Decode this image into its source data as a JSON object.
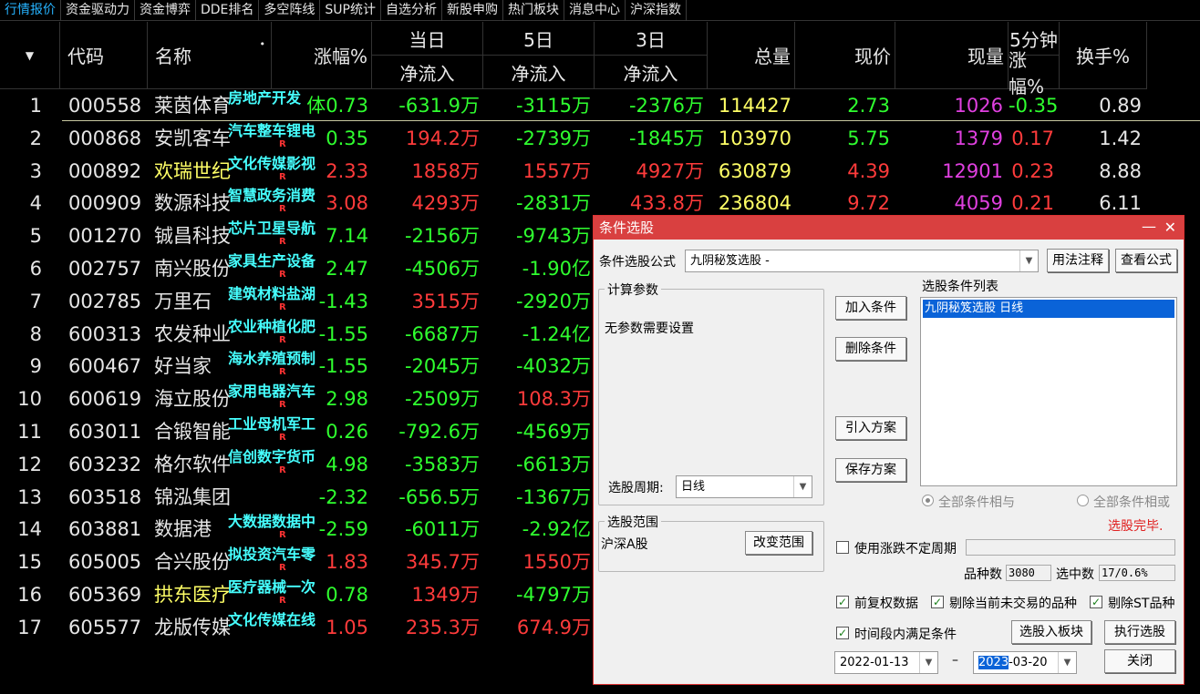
{
  "tabs": [
    "行情报价",
    "资金驱动力",
    "资金博弈",
    "DDE排名",
    "多空阵线",
    "SUP统计",
    "自选分析",
    "新股申购",
    "热门板块",
    "消息中心",
    "沪深指数"
  ],
  "header": {
    "sort_symbol": "▼",
    "code": "代码",
    "name": "名称",
    "name_dot": "•",
    "change": "涨幅%",
    "day": "当日",
    "five_day": "5日",
    "three_day": "3日",
    "net_inflow": "净流入",
    "volume": "总量",
    "price": "现价",
    "current_vol": "现量",
    "five_min": "5分钟",
    "five_min_change": "涨幅%",
    "turnover": "换手%"
  },
  "colors": {
    "red": "#ff3b3b",
    "green": "#2fff2f",
    "yellow": "#ffff66",
    "magenta": "#e040e0",
    "cyan": "#46ffff",
    "white": "#e6e6e6"
  },
  "rows": [
    {
      "idx": "1",
      "code": "000558",
      "name": "莱茵体育",
      "ind": "房地产开发",
      "r": "",
      "chg": "体0.73",
      "chg_c": "green",
      "day": "-631.9万",
      "day_c": "green",
      "d5": "-3115万",
      "d5_c": "green",
      "d3": "-2376万",
      "d3_c": "green",
      "vol": "114427",
      "price": "2.73",
      "price_c": "green",
      "cur": "1026",
      "m5": "-0.35",
      "m5_c": "green",
      "turn": "0.89",
      "name_yellow": false
    },
    {
      "idx": "2",
      "code": "000868",
      "name": "安凯客车",
      "ind": "汽车整车锂电",
      "r": "R",
      "chg": "0.35",
      "chg_c": "green",
      "day": "194.2万",
      "day_c": "red",
      "d5": "-2739万",
      "d5_c": "green",
      "d3": "-1845万",
      "d3_c": "green",
      "vol": "103970",
      "price": "5.75",
      "price_c": "green",
      "cur": "1379",
      "m5": "0.17",
      "m5_c": "red",
      "turn": "1.42",
      "name_yellow": false
    },
    {
      "idx": "3",
      "code": "000892",
      "name": "欢瑞世纪",
      "ind": "文化传媒影视",
      "r": "R",
      "chg": "2.33",
      "chg_c": "red",
      "day": "1858万",
      "day_c": "red",
      "d5": "1557万",
      "d5_c": "red",
      "d3": "4927万",
      "d3_c": "red",
      "vol": "630879",
      "price": "4.39",
      "price_c": "red",
      "cur": "12901",
      "m5": "0.23",
      "m5_c": "red",
      "turn": "8.88",
      "name_yellow": true
    },
    {
      "idx": "4",
      "code": "000909",
      "name": "数源科技",
      "ind": "智慧政务消费",
      "r": "R",
      "chg": "3.08",
      "chg_c": "red",
      "day": "4293万",
      "day_c": "red",
      "d5": "-2831万",
      "d5_c": "green",
      "d3": "433.8万",
      "d3_c": "red",
      "vol": "236804",
      "price": "9.72",
      "price_c": "red",
      "cur": "4059",
      "m5": "0.21",
      "m5_c": "red",
      "turn": "6.11",
      "name_yellow": false
    },
    {
      "idx": "5",
      "code": "001270",
      "name": "铖昌科技",
      "ind": "芯片卫星导航",
      "r": "R",
      "chg": "7.14",
      "chg_c": "green",
      "day": "-2156万",
      "day_c": "green",
      "d5": "-9743万",
      "d5_c": "green",
      "name_yellow": false
    },
    {
      "idx": "6",
      "code": "002757",
      "name": "南兴股份",
      "ind": "家具生产设备",
      "r": "R",
      "chg": "2.47",
      "chg_c": "green",
      "day": "-4506万",
      "day_c": "green",
      "d5": "-1.90亿",
      "d5_c": "green",
      "name_yellow": false
    },
    {
      "idx": "7",
      "code": "002785",
      "name": "万里石",
      "ind": "建筑材料盐湖",
      "r": "R",
      "chg": "-1.43",
      "chg_c": "green",
      "day": "3515万",
      "day_c": "red",
      "d5": "-2920万",
      "d5_c": "green",
      "name_yellow": false
    },
    {
      "idx": "8",
      "code": "600313",
      "name": "农发种业",
      "ind": "农业种植化肥",
      "r": "R",
      "chg": "-1.55",
      "chg_c": "green",
      "day": "-6687万",
      "day_c": "green",
      "d5": "-1.24亿",
      "d5_c": "green",
      "name_yellow": false
    },
    {
      "idx": "9",
      "code": "600467",
      "name": "好当家",
      "ind": "海水养殖预制",
      "r": "R",
      "chg": "-1.55",
      "chg_c": "green",
      "day": "-2045万",
      "day_c": "green",
      "d5": "-4032万",
      "d5_c": "green",
      "name_yellow": false
    },
    {
      "idx": "10",
      "code": "600619",
      "name": "海立股份",
      "ind": "家用电器汽车",
      "r": "R",
      "chg": "2.98",
      "chg_c": "green",
      "day": "-2509万",
      "day_c": "green",
      "d5": "108.3万",
      "d5_c": "red",
      "name_yellow": false
    },
    {
      "idx": "11",
      "code": "603011",
      "name": "合锻智能",
      "ind": "工业母机军工",
      "r": "R",
      "chg": "0.26",
      "chg_c": "green",
      "day": "-792.6万",
      "day_c": "green",
      "d5": "-4569万",
      "d5_c": "green",
      "name_yellow": false
    },
    {
      "idx": "12",
      "code": "603232",
      "name": "格尔软件",
      "ind": "信创数字货币",
      "r": "R",
      "chg": "4.98",
      "chg_c": "green",
      "day": "-3583万",
      "day_c": "green",
      "d5": "-6613万",
      "d5_c": "green",
      "name_yellow": false
    },
    {
      "idx": "13",
      "code": "603518",
      "name": "锦泓集团",
      "ind": "",
      "r": "",
      "chg": "-2.32",
      "chg_c": "green",
      "day": "-656.5万",
      "day_c": "green",
      "d5": "-1367万",
      "d5_c": "green",
      "name_yellow": false
    },
    {
      "idx": "14",
      "code": "603881",
      "name": "数据港",
      "ind": "大数据数据中",
      "r": "R",
      "chg": "-2.59",
      "chg_c": "green",
      "day": "-6011万",
      "day_c": "green",
      "d5": "-2.92亿",
      "d5_c": "green",
      "name_yellow": false
    },
    {
      "idx": "15",
      "code": "605005",
      "name": "合兴股份",
      "ind": "拟投资汽车零",
      "r": "R",
      "chg": "1.83",
      "chg_c": "red",
      "day": "345.7万",
      "day_c": "red",
      "d5": "1550万",
      "d5_c": "red",
      "name_yellow": false
    },
    {
      "idx": "16",
      "code": "605369",
      "name": "拱东医疗",
      "ind": "医疗器械一次",
      "r": "R",
      "chg": "0.78",
      "chg_c": "green",
      "day": "1349万",
      "day_c": "red",
      "d5": "-4797万",
      "d5_c": "green",
      "name_yellow": true
    },
    {
      "idx": "17",
      "code": "605577",
      "name": "龙版传媒",
      "ind": "文化传媒在线",
      "r": "",
      "chg": "1.05",
      "chg_c": "red",
      "day": "235.3万",
      "day_c": "red",
      "d5": "674.9万",
      "d5_c": "red",
      "name_yellow": false
    }
  ],
  "dialog": {
    "title": "条件选股",
    "min_symbol": "—",
    "close_symbol": "✕",
    "formula_label": "条件选股公式",
    "formula_value": "九阴秘笈选股 -",
    "usage_btn": "用法注释",
    "view_formula_btn": "查看公式",
    "calc_params_title": "计算参数",
    "no_params": "无参数需要设置",
    "period_label": "选股周期:",
    "period_value": "日线",
    "add_cond_btn": "加入条件",
    "del_cond_btn": "删除条件",
    "import_btn": "引入方案",
    "save_btn": "保存方案",
    "cond_list_label": "选股条件列表",
    "cond_item": "九阴秘笈选股  日线",
    "radio_and": "全部条件相与",
    "radio_or": "全部条件相或",
    "status": "选股完毕.",
    "range_title": "选股范围",
    "range_value": "沪深A股",
    "change_range_btn": "改变范围",
    "use_period_label": "使用涨跌不定周期",
    "count_label": "品种数",
    "count_value": "3080",
    "selected_label": "选中数",
    "selected_value": "17/0.6%",
    "pre_adjust": "前复权数据",
    "exclude_untraded": "剔除当前未交易的品种",
    "exclude_st": "剔除ST品种",
    "time_range": "时间段内满足条件",
    "to_block_btn": "选股入板块",
    "exec_btn": "执行选股",
    "close_btn": "关闭",
    "date_from": "2022-01-13",
    "dash": "–",
    "date_to_year": "2023",
    "date_to_rest": "-03-20",
    "combo_arrow": "▼",
    "check_mark": "✓"
  }
}
